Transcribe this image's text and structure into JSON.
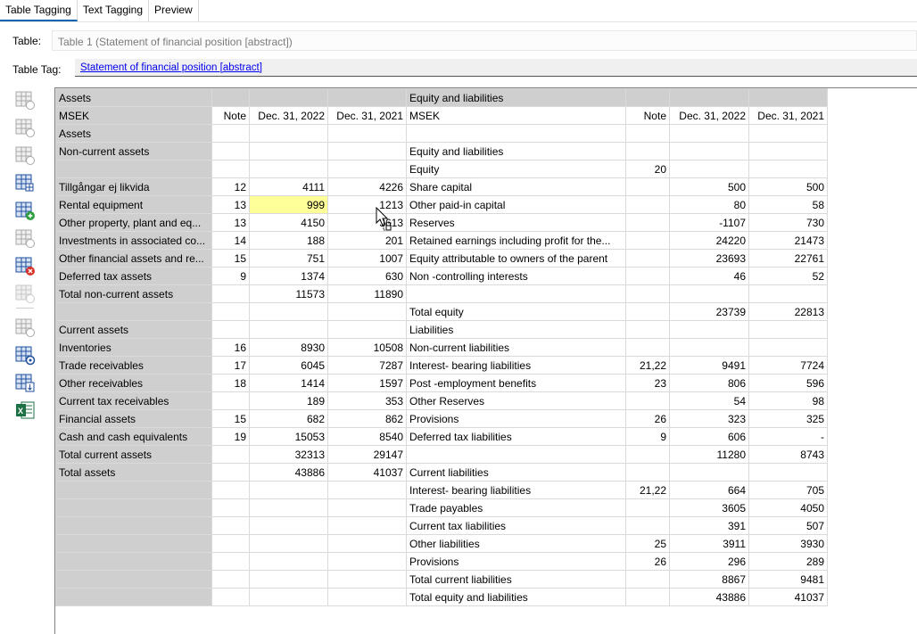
{
  "tabs": [
    "Table Tagging",
    "Text Tagging",
    "Preview"
  ],
  "table_label": "Table:",
  "table_value": "Table 1 (Statement of financial position [abstract])",
  "tag_label": "Table Tag:",
  "tag_value": "Statement of financial position [abstract]",
  "toolbar_icons": [
    {
      "name": "table-add-row-icon",
      "color": "#a8a8a8"
    },
    {
      "name": "table-insert-icon",
      "color": "#a8a8a8"
    },
    {
      "name": "table-edit-icon",
      "color": "#a8a8a8"
    },
    {
      "name": "table-grid-icon",
      "color": "#1f4e9c"
    },
    {
      "name": "table-add-icon",
      "color": "#1f4e9c"
    },
    {
      "name": "table-remove-icon",
      "color": "#a8a8a8"
    },
    {
      "name": "table-delete-icon",
      "color": "#1f4e9c"
    },
    {
      "name": "table-star-icon",
      "color": "#c8c8c8"
    },
    {
      "name": "table-lock-icon",
      "color": "#a8a8a8"
    },
    {
      "name": "table-settings-icon",
      "color": "#1f4e9c"
    },
    {
      "name": "table-export-icon",
      "color": "#1f4e9c"
    },
    {
      "name": "excel-icon",
      "color": "#1e7145"
    }
  ],
  "rows": [
    [
      "Assets",
      "",
      "",
      "",
      "Equity and liabilities",
      "",
      "",
      ""
    ],
    [
      "MSEK",
      "Note",
      "Dec. 31, 2022",
      "Dec. 31, 2021",
      "MSEK",
      "Note",
      "Dec. 31, 2022",
      "Dec. 31, 2021"
    ],
    [
      "Assets",
      "",
      "",
      "",
      "",
      "",
      "",
      ""
    ],
    [
      "Non-current assets",
      "",
      "",
      "",
      "Equity and liabilities",
      "",
      "",
      ""
    ],
    [
      "",
      "",
      "",
      "",
      "Equity",
      "20",
      "",
      ""
    ],
    [
      "Tillgångar ej likvida",
      "12",
      "4111",
      "4226",
      "Share capital",
      "",
      "500",
      "500"
    ],
    [
      "Rental equipment",
      "13",
      "999",
      "1213",
      "Other paid-in capital",
      "",
      "80",
      "58"
    ],
    [
      "Other property, plant and eq...",
      "13",
      "4150",
      "3613",
      "Reserves",
      "",
      "-1107",
      "730"
    ],
    [
      "Investments in associated co...",
      "14",
      "188",
      "201",
      "Retained earnings including profit for the...",
      "",
      "24220",
      "21473"
    ],
    [
      "Other financial assets and re...",
      "15",
      "751",
      "1007",
      "Equity attributable to owners of the parent",
      "",
      "23693",
      "22761"
    ],
    [
      "Deferred tax assets",
      "9",
      "1374",
      "630",
      "Non -controlling interests",
      "",
      "46",
      "52"
    ],
    [
      "Total non-current assets",
      "",
      "11573",
      "11890",
      "",
      "",
      "",
      ""
    ],
    [
      "",
      "",
      "",
      "",
      "Total equity",
      "",
      "23739",
      "22813"
    ],
    [
      "Current assets",
      "",
      "",
      "",
      "Liabilities",
      "",
      "",
      ""
    ],
    [
      "Inventories",
      "16",
      "8930",
      "10508",
      "Non-current liabilities",
      "",
      "",
      ""
    ],
    [
      "Trade receivables",
      "17",
      "6045",
      "7287",
      "Interest- bearing liabilities",
      "21,22",
      "9491",
      "7724"
    ],
    [
      "Other receivables",
      "18",
      "1414",
      "1597",
      "Post -employment benefits",
      "23",
      "806",
      "596"
    ],
    [
      "Current tax receivables",
      "",
      "189",
      "353",
      "Other Reserves",
      "",
      "54",
      "98"
    ],
    [
      "Financial assets",
      "15",
      "682",
      "862",
      "Provisions",
      "26",
      "323",
      "325"
    ],
    [
      "Cash and cash equivalents",
      "19",
      "15053",
      "8540",
      "Deferred tax liabilities",
      "9",
      "606",
      "-"
    ],
    [
      "Total current assets",
      "",
      "32313",
      "29147",
      "",
      "",
      "11280",
      "8743"
    ],
    [
      "Total assets",
      "",
      "43886",
      "41037",
      "Current liabilities",
      "",
      "",
      ""
    ],
    [
      "",
      "",
      "",
      "",
      "Interest- bearing liabilities",
      "21,22",
      "664",
      "705"
    ],
    [
      "",
      "",
      "",
      "",
      "Trade payables",
      "",
      "3605",
      "4050"
    ],
    [
      "",
      "",
      "",
      "",
      "Current tax liabilities",
      "",
      "391",
      "507"
    ],
    [
      "",
      "",
      "",
      "",
      "Other liabilities",
      "25",
      "3911",
      "3930"
    ],
    [
      "",
      "",
      "",
      "",
      "Provisions",
      "26",
      "296",
      "289"
    ],
    [
      "",
      "",
      "",
      "",
      "Total current liabilities",
      "",
      "8867",
      "9481"
    ],
    [
      "",
      "",
      "",
      "",
      "Total equity and liabilities",
      "",
      "43886",
      "41037"
    ]
  ]
}
